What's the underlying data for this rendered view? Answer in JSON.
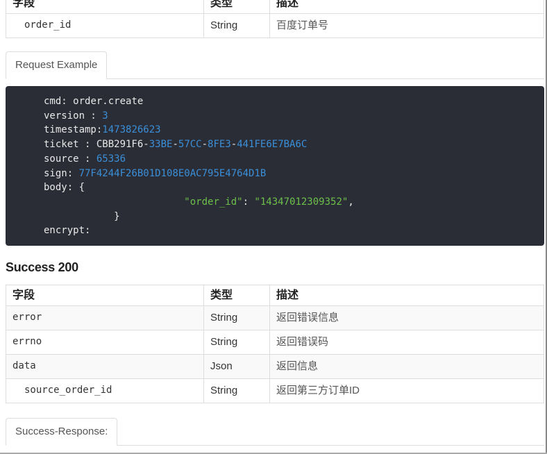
{
  "top_table": {
    "headers": [
      "字段",
      "类型",
      "描述"
    ],
    "rows": [
      {
        "field": "order_id",
        "type": "String",
        "desc": "百度订单号"
      }
    ]
  },
  "request_tab": {
    "label": "Request Example"
  },
  "code": {
    "cmd_key": "cmd: ",
    "cmd_val": "order.create",
    "version_key": "version : ",
    "version_val": "3",
    "timestamp_key": "timestamp:",
    "timestamp_val": "1473826623",
    "ticket_key": "ticket : ",
    "ticket_parts": [
      "CBB291F6",
      "-",
      "33BE",
      "-",
      "57CC",
      "-",
      "8FE3",
      "-",
      "441FE6E7BA6C"
    ],
    "source_key": "source : ",
    "source_val": "65336",
    "sign_key": "sign: ",
    "sign_val": "77F4244F26B01D108E0AC795E4764D1B",
    "body_key": "body: {",
    "body_field": "\"order_id\"",
    "body_sep": ": ",
    "body_value": "\"14347012309352\"",
    "body_comma": ",",
    "body_close": "}",
    "encrypt_key": "encrypt:"
  },
  "success_heading": "Success 200",
  "success_table": {
    "headers": [
      "字段",
      "类型",
      "描述"
    ],
    "rows": [
      {
        "field": "error",
        "type": "String",
        "desc": "返回错误信息"
      },
      {
        "field": "errno",
        "type": "String",
        "desc": "返回错误码"
      },
      {
        "field": "data",
        "type": "Json",
        "desc": "返回信息"
      },
      {
        "field": "source_order_id",
        "type": "String",
        "desc": "返回第三方订单ID"
      }
    ]
  },
  "response_tab": {
    "label": "Success-Response:"
  },
  "colors": {
    "code_bg": "#2b2d36",
    "number": "#3a8fd9",
    "string": "#6cc04a"
  }
}
